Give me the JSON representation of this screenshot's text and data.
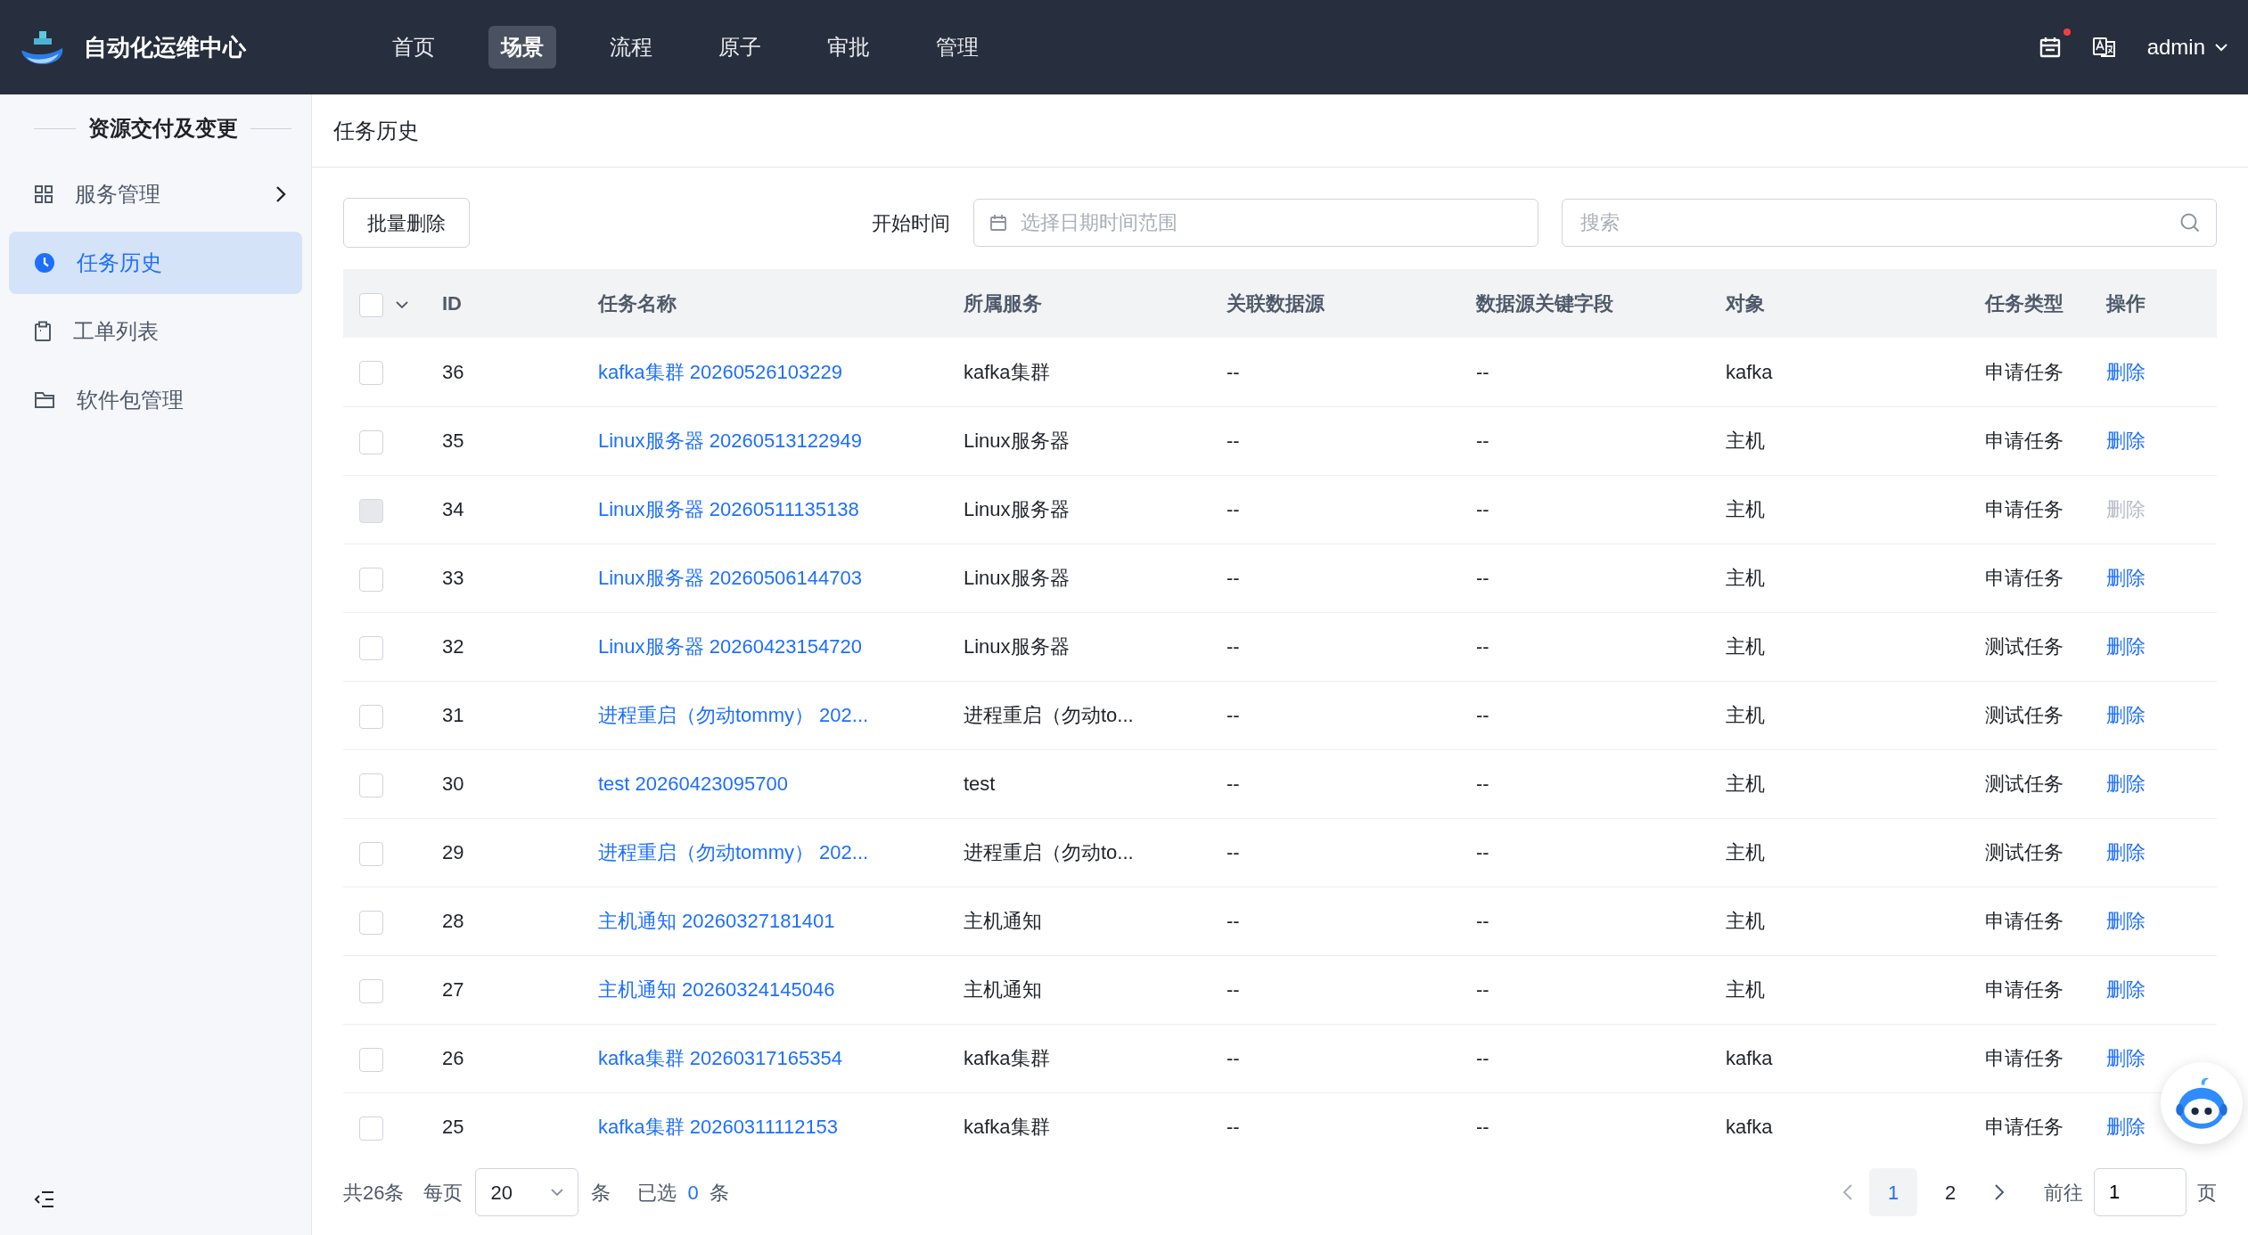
{
  "header": {
    "app_title": "自动化运维中心",
    "nav": [
      {
        "label": "首页",
        "selected": false
      },
      {
        "label": "场景",
        "selected": true
      },
      {
        "label": "流程",
        "selected": false
      },
      {
        "label": "原子",
        "selected": false
      },
      {
        "label": "审批",
        "selected": false
      },
      {
        "label": "管理",
        "selected": false
      }
    ],
    "notification_dot": true,
    "user": "admin"
  },
  "sidebar": {
    "section_title": "资源交付及变更",
    "items": [
      {
        "label": "服务管理",
        "kind": "group",
        "selected": false
      },
      {
        "label": "任务历史",
        "kind": "link",
        "selected": true
      },
      {
        "label": "工单列表",
        "kind": "link",
        "selected": false
      },
      {
        "label": "软件包管理",
        "kind": "link",
        "selected": false
      }
    ]
  },
  "page_title": "任务历史",
  "toolbar": {
    "batch_delete": "批量删除",
    "start_time_label": "开始时间",
    "date_range": {
      "placeholder": "选择日期时间范围"
    },
    "search": {
      "placeholder": "搜索"
    }
  },
  "table": {
    "select_all": {
      "checked": false
    },
    "columns": [
      "ID",
      "任务名称",
      "所属服务",
      "关联数据源",
      "数据源关键字段",
      "对象",
      "任务类型",
      "操作"
    ],
    "rows": [
      {
        "checked": false,
        "disabled": false,
        "id": "36",
        "name": "kafka集群 20260526103229",
        "service": "kafka集群",
        "datasource": "--",
        "key_field": "--",
        "object": "kafka",
        "task_type": "申请任务",
        "action": "删除"
      },
      {
        "checked": false,
        "disabled": false,
        "id": "35",
        "name": "Linux服务器 20260513122949",
        "service": "Linux服务器",
        "datasource": "--",
        "key_field": "--",
        "object": "主机",
        "task_type": "申请任务",
        "action": "删除"
      },
      {
        "checked": false,
        "disabled": true,
        "id": "34",
        "name": "Linux服务器 20260511135138",
        "service": "Linux服务器",
        "datasource": "--",
        "key_field": "--",
        "object": "主机",
        "task_type": "申请任务",
        "action": "删除"
      },
      {
        "checked": false,
        "disabled": false,
        "id": "33",
        "name": "Linux服务器 20260506144703",
        "service": "Linux服务器",
        "datasource": "--",
        "key_field": "--",
        "object": "主机",
        "task_type": "申请任务",
        "action": "删除"
      },
      {
        "checked": false,
        "disabled": false,
        "id": "32",
        "name": "Linux服务器 20260423154720",
        "service": "Linux服务器",
        "datasource": "--",
        "key_field": "--",
        "object": "主机",
        "task_type": "测试任务",
        "action": "删除"
      },
      {
        "checked": false,
        "disabled": false,
        "id": "31",
        "name": "进程重启（勿动tommy） 202...",
        "service": "进程重启（勿动to...",
        "datasource": "--",
        "key_field": "--",
        "object": "主机",
        "task_type": "测试任务",
        "action": "删除"
      },
      {
        "checked": false,
        "disabled": false,
        "id": "30",
        "name": "test 20260423095700",
        "service": "test",
        "datasource": "--",
        "key_field": "--",
        "object": "主机",
        "task_type": "测试任务",
        "action": "删除"
      },
      {
        "checked": false,
        "disabled": false,
        "id": "29",
        "name": "进程重启（勿动tommy） 202...",
        "service": "进程重启（勿动to...",
        "datasource": "--",
        "key_field": "--",
        "object": "主机",
        "task_type": "测试任务",
        "action": "删除"
      },
      {
        "checked": false,
        "disabled": false,
        "id": "28",
        "name": "主机通知 20260327181401",
        "service": "主机通知",
        "datasource": "--",
        "key_field": "--",
        "object": "主机",
        "task_type": "申请任务",
        "action": "删除"
      },
      {
        "checked": false,
        "disabled": false,
        "id": "27",
        "name": "主机通知 20260324145046",
        "service": "主机通知",
        "datasource": "--",
        "key_field": "--",
        "object": "主机",
        "task_type": "申请任务",
        "action": "删除"
      },
      {
        "checked": false,
        "disabled": false,
        "id": "26",
        "name": "kafka集群 20260317165354",
        "service": "kafka集群",
        "datasource": "--",
        "key_field": "--",
        "object": "kafka",
        "task_type": "申请任务",
        "action": "删除"
      },
      {
        "checked": false,
        "disabled": false,
        "id": "25",
        "name": "kafka集群 20260311112153",
        "service": "kafka集群",
        "datasource": "--",
        "key_field": "--",
        "object": "kafka",
        "task_type": "申请任务",
        "action": "删除"
      }
    ]
  },
  "pagination": {
    "total": "共26条",
    "per_page_label": "每页",
    "page_size": "20",
    "per_page_unit": "条",
    "selected_label": "已选",
    "selected_count": "0",
    "selected_unit": "条",
    "pages": [
      {
        "label": "1",
        "selected": true
      },
      {
        "label": "2",
        "selected": false
      }
    ],
    "goto_label": "前往",
    "goto_value": "1",
    "goto_unit": "页"
  }
}
